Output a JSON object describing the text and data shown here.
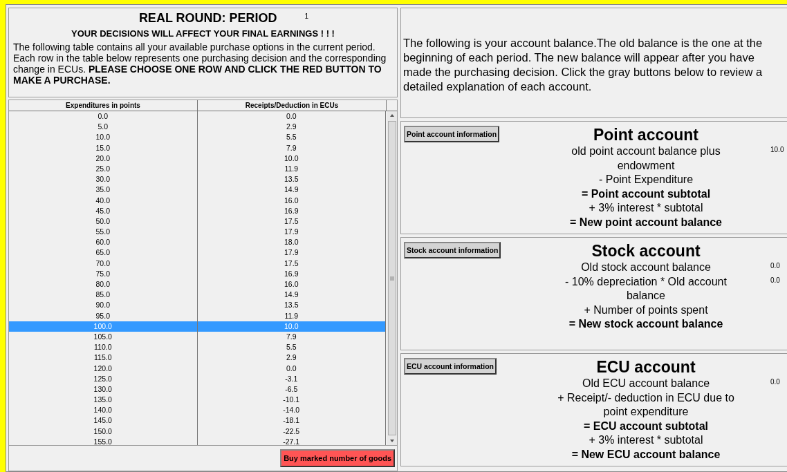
{
  "header": {
    "title": "REAL ROUND: PERIOD",
    "period": "1",
    "warning": "YOUR DECISIONS WILL AFFECT YOUR FINAL EARNINGS ! ! !",
    "instructions": "The following table contains all your available purchase options in the current period. Each row in the table below represents one purchasing decision and the corresponding change in ECUs.  **PLEASE CHOOSE ONE ROW AND CLICK THE RED BUTTON TO MAKE A PURCHASE.**"
  },
  "table": {
    "columns": [
      "Expenditures in points",
      "Receipts/Deduction in ECUs"
    ],
    "rows": [
      {
        "cells": [
          "0.0",
          "0.0"
        ],
        "selected": false
      },
      {
        "cells": [
          "5.0",
          "2.9"
        ],
        "selected": false
      },
      {
        "cells": [
          "10.0",
          "5.5"
        ],
        "selected": false
      },
      {
        "cells": [
          "15.0",
          "7.9"
        ],
        "selected": false
      },
      {
        "cells": [
          "20.0",
          "10.0"
        ],
        "selected": false
      },
      {
        "cells": [
          "25.0",
          "11.9"
        ],
        "selected": false
      },
      {
        "cells": [
          "30.0",
          "13.5"
        ],
        "selected": false
      },
      {
        "cells": [
          "35.0",
          "14.9"
        ],
        "selected": false
      },
      {
        "cells": [
          "40.0",
          "16.0"
        ],
        "selected": false
      },
      {
        "cells": [
          "45.0",
          "16.9"
        ],
        "selected": false
      },
      {
        "cells": [
          "50.0",
          "17.5"
        ],
        "selected": false
      },
      {
        "cells": [
          "55.0",
          "17.9"
        ],
        "selected": false
      },
      {
        "cells": [
          "60.0",
          "18.0"
        ],
        "selected": false
      },
      {
        "cells": [
          "65.0",
          "17.9"
        ],
        "selected": false
      },
      {
        "cells": [
          "70.0",
          "17.5"
        ],
        "selected": false
      },
      {
        "cells": [
          "75.0",
          "16.9"
        ],
        "selected": false
      },
      {
        "cells": [
          "80.0",
          "16.0"
        ],
        "selected": false
      },
      {
        "cells": [
          "85.0",
          "14.9"
        ],
        "selected": false
      },
      {
        "cells": [
          "90.0",
          "13.5"
        ],
        "selected": false
      },
      {
        "cells": [
          "95.0",
          "11.9"
        ],
        "selected": false
      },
      {
        "cells": [
          "100.0",
          "10.0"
        ],
        "selected": true
      },
      {
        "cells": [
          "105.0",
          "7.9"
        ],
        "selected": false
      },
      {
        "cells": [
          "110.0",
          "5.5"
        ],
        "selected": false
      },
      {
        "cells": [
          "115.0",
          "2.9"
        ],
        "selected": false
      },
      {
        "cells": [
          "120.0",
          "0.0"
        ],
        "selected": false
      },
      {
        "cells": [
          "125.0",
          "-3.1"
        ],
        "selected": false
      },
      {
        "cells": [
          "130.0",
          "-6.5"
        ],
        "selected": false
      },
      {
        "cells": [
          "135.0",
          "-10.1"
        ],
        "selected": false
      },
      {
        "cells": [
          "140.0",
          "-14.0"
        ],
        "selected": false
      },
      {
        "cells": [
          "145.0",
          "-18.1"
        ],
        "selected": false
      },
      {
        "cells": [
          "150.0",
          "-22.5"
        ],
        "selected": false
      },
      {
        "cells": [
          "155.0",
          "-27.1"
        ],
        "selected": false
      }
    ]
  },
  "buy_button": "Buy marked number of goods",
  "balance_intro": "The following is your account balance.The old balance is the one at the beginning of each period. The new balance will appear after you have made the purchasing decision. Click the gray buttons below to review a detailed explanation of each account.",
  "accounts": [
    {
      "button": "Point account information",
      "title": "Point account",
      "lines": [
        {
          "text": "old point account balance plus endowment",
          "bold": false,
          "value": "10.0"
        },
        {
          "text": "- Point Expenditure",
          "bold": false
        },
        {
          "text": "= Point account subtotal",
          "bold": true
        },
        {
          "text": "+ 3% interest * subtotal",
          "bold": false
        },
        {
          "text": "= New point account balance",
          "bold": true
        }
      ]
    },
    {
      "button": "Stock account information",
      "title": "Stock account",
      "lines": [
        {
          "text": "Old stock account balance",
          "bold": false,
          "value": "0.0"
        },
        {
          "text": "- 10% depreciation * Old account balance",
          "bold": false,
          "value": "0.0"
        },
        {
          "text": "+ Number of points spent",
          "bold": false
        },
        {
          "text": "= New stock account balance",
          "bold": true
        }
      ]
    },
    {
      "button": "ECU account information",
      "title": "ECU account",
      "lines": [
        {
          "text": "Old ECU account balance",
          "bold": false,
          "value": "0.0"
        },
        {
          "text": "+ Receipt/- deduction in ECU due to point expenditure",
          "bold": false
        },
        {
          "text": "= ECU account subtotal",
          "bold": true
        },
        {
          "text": "+ 3% interest * subtotal",
          "bold": false
        },
        {
          "text": "= New ECU account balance",
          "bold": true
        }
      ]
    }
  ]
}
